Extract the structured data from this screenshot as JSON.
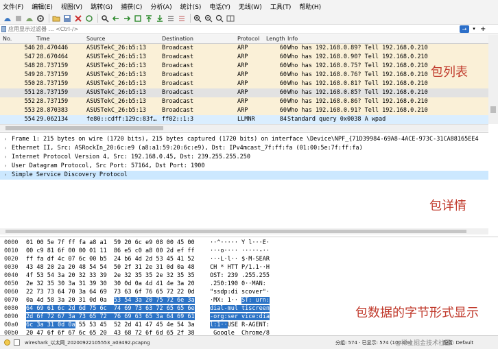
{
  "colors": {
    "row_arp": "#faf0d7",
    "row_selected": "#e2e2e2",
    "row_llmnr": "#daeeff",
    "detail_selected": "#cce8ff",
    "byte_highlight": "#2c73c6",
    "annotation": "#c0392b"
  },
  "menu": [
    "文件(F)",
    "编辑(E)",
    "视图(V)",
    "跳转(G)",
    "捕获(C)",
    "分析(A)",
    "统计(S)",
    "电话(Y)",
    "无线(W)",
    "工具(T)",
    "帮助(H)"
  ],
  "toolbar_icons": [
    "shark-fin-start-icon",
    "stop-icon",
    "restart-icon",
    "options-gear-icon",
    "open-folder-icon",
    "save-icon",
    "close-file-icon",
    "reload-icon",
    "find-icon",
    "back-arrow-icon",
    "forward-arrow-icon",
    "goto-packet-icon",
    "first-packet-icon",
    "last-packet-icon",
    "autoscroll-icon",
    "colorize-icon",
    "zoom-in-icon",
    "zoom-out-icon",
    "zoom-reset-icon",
    "resize-columns-icon"
  ],
  "filter": {
    "placeholder": "应用显示过滤器 … <Ctrl-/>"
  },
  "packet_list": {
    "columns": [
      "No.",
      "Time",
      "Source",
      "Destination",
      "Protocol",
      "Length",
      "Info"
    ],
    "rows": [
      {
        "no": "546",
        "time": "28.470446",
        "src": "ASUSTekC_26:b5:13",
        "dst": "Broadcast",
        "proto": "ARP",
        "len": "60",
        "info": "Who has 192.168.0.89? Tell 192.168.0.210",
        "kind": "arp"
      },
      {
        "no": "547",
        "time": "28.670464",
        "src": "ASUSTekC_26:b5:13",
        "dst": "Broadcast",
        "proto": "ARP",
        "len": "60",
        "info": "Who has 192.168.0.90? Tell 192.168.0.210",
        "kind": "arp"
      },
      {
        "no": "548",
        "time": "28.737159",
        "src": "ASUSTekC_26:b5:13",
        "dst": "Broadcast",
        "proto": "ARP",
        "len": "60",
        "info": "Who has 192.168.0.75? Tell 192.168.0.210",
        "kind": "arp"
      },
      {
        "no": "549",
        "time": "28.737159",
        "src": "ASUSTekC_26:b5:13",
        "dst": "Broadcast",
        "proto": "ARP",
        "len": "60",
        "info": "Who has 192.168.0.76? Tell 192.168.0.210",
        "kind": "arp"
      },
      {
        "no": "550",
        "time": "28.737159",
        "src": "ASUSTekC_26:b5:13",
        "dst": "Broadcast",
        "proto": "ARP",
        "len": "60",
        "info": "Who has 192.168.0.81? Tell 192.168.0.210",
        "kind": "arp"
      },
      {
        "no": "551",
        "time": "28.737159",
        "src": "ASUSTekC_26:b5:13",
        "dst": "Broadcast",
        "proto": "ARP",
        "len": "60",
        "info": "Who has 192.168.0.85? Tell 192.168.0.210",
        "kind": "selected"
      },
      {
        "no": "552",
        "time": "28.737159",
        "src": "ASUSTekC_26:b5:13",
        "dst": "Broadcast",
        "proto": "ARP",
        "len": "60",
        "info": "Who has 192.168.0.86? Tell 192.168.0.210",
        "kind": "arp"
      },
      {
        "no": "553",
        "time": "28.870383",
        "src": "ASUSTekC_26:b5:13",
        "dst": "Broadcast",
        "proto": "ARP",
        "len": "60",
        "info": "Who has 192.168.0.91? Tell 192.168.0.210",
        "kind": "arp"
      },
      {
        "no": "554",
        "time": "29.062134",
        "src": "fe80::cdff:129c:83f…",
        "dst": "ff02::1:3",
        "proto": "LLMNR",
        "len": "84",
        "info": "Standard query 0x0038 A wpad",
        "kind": "llmnr"
      }
    ]
  },
  "details": [
    {
      "text": "Frame 1: 215 bytes on wire (1720 bits), 215 bytes captured (1720 bits) on interface \\Device\\NPF_{71D39984-69A8-4ACE-973C-31CA88165EE4",
      "selected": false
    },
    {
      "text": "Ethernet II, Src: ASRockIn_20:6c:e9 (a8:a1:59:20:6c:e9), Dst: IPv4mcast_7f:ff:fa (01:00:5e:7f:ff:fa)",
      "selected": false
    },
    {
      "text": "Internet Protocol Version 4, Src: 192.168.0.45, Dst: 239.255.255.250",
      "selected": false
    },
    {
      "text": "User Datagram Protocol, Src Port: 57164, Dst Port: 1900",
      "selected": false
    },
    {
      "text": "Simple Service Discovery Protocol",
      "selected": true
    }
  ],
  "bytes": [
    {
      "off": "0000",
      "hex": "01 00 5e 7f ff fa a8 a1  59 20 6c e9 08 00 45 00",
      "ascii": "··^····· Y l···E·",
      "hs": -1,
      "he": -1,
      "as": -1,
      "ae": -1
    },
    {
      "off": "0010",
      "hex": "00 c9 81 6f 00 00 01 11  86 e5 c0 a8 00 2d ef ff",
      "ascii": "···o···· ·····-··",
      "hs": -1,
      "he": -1,
      "as": -1,
      "ae": -1
    },
    {
      "off": "0020",
      "hex": "ff fa df 4c 07 6c 00 b5  24 b6 4d 2d 53 45 41 52",
      "ascii": "···L·l·· $·M-SEAR",
      "hs": -1,
      "he": -1,
      "as": -1,
      "ae": -1
    },
    {
      "off": "0030",
      "hex": "43 48 20 2a 20 48 54 54  50 2f 31 2e 31 0d 0a 48",
      "ascii": "CH * HTT P/1.1··H",
      "hs": -1,
      "he": -1,
      "as": -1,
      "ae": -1
    },
    {
      "off": "0040",
      "hex": "4f 53 54 3a 20 32 33 39  2e 32 35 35 2e 32 35 35",
      "ascii": "OST: 239 .255.255",
      "hs": -1,
      "he": -1,
      "as": -1,
      "ae": -1
    },
    {
      "off": "0050",
      "hex": "2e 32 35 30 3a 31 39 30  30 0d 0a 4d 41 4e 3a 20",
      "ascii": ".250:190 0··MAN: ",
      "hs": -1,
      "he": -1,
      "as": -1,
      "ae": -1
    },
    {
      "off": "0060",
      "hex": "22 73 73 64 70 3a 64 69  73 63 6f 76 65 72 22 0d",
      "ascii": "\"ssdp:di scover\"·",
      "hs": -1,
      "he": -1,
      "as": -1,
      "ae": -1
    },
    {
      "off": "0070",
      "hex": "0a 4d 58 3a 20 31 0d 0a  53 54 3a 20 75 72 6e 3a",
      "ascii": "·MX: 1·· ST: urn:",
      "hs": 25,
      "he": 48,
      "as": 9,
      "ae": 17
    },
    {
      "off": "0080",
      "hex": "64 69 61 6c 2d 6d 75 6c  74 69 73 63 72 65 65 6e",
      "ascii": "dial-mul tiscreen",
      "hs": 0,
      "he": 48,
      "as": 0,
      "ae": 17
    },
    {
      "off": "0090",
      "hex": "2d 6f 72 67 3a 73 65 72  76 69 63 65 3a 64 69 61",
      "ascii": "-org:ser vice:dia",
      "hs": 0,
      "he": 48,
      "as": 0,
      "ae": 17
    },
    {
      "off": "00a0",
      "hex": "6c 3a 31 0d 0a 55 53 45  52 2d 41 47 45 4e 54 3a",
      "ascii": "l:1··USE R-AGENT:",
      "hs": 0,
      "he": 14,
      "as": 0,
      "ae": 5
    },
    {
      "off": "00b0",
      "hex": "20 47 6f 6f 67 6c 65 20  43 68 72 6f 6d 65 2f 38",
      "ascii": " Google  Chrome/8",
      "hs": -1,
      "he": -1,
      "as": -1,
      "ae": -1
    }
  ],
  "annotations": {
    "packet_list": "包列表",
    "details": "包详情",
    "bytes": "包数据的字节形式显示"
  },
  "status": {
    "file": "wireshark_以太网_20200922105553_a03492.pcapng",
    "stats": "分组: 574 · 已显示: 574 (100.0%)",
    "profile": "配置: Default",
    "watermark": "@稀土掘金技术社区"
  }
}
